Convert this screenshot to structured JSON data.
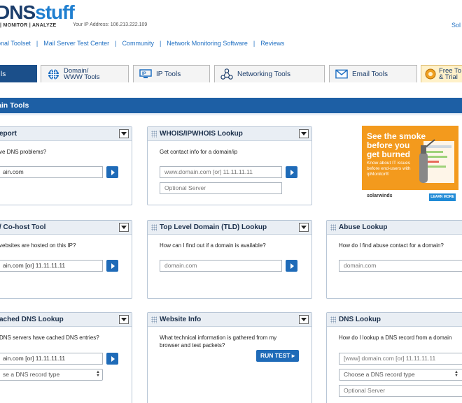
{
  "header": {
    "logo_text": "DNS",
    "logo_suffix": "stuff",
    "logo_tagline": "| MONITOR | ANALYZE",
    "ip_text": "Your IP Address: 106.213.222.109",
    "top_right_link": "Sol"
  },
  "topnav": {
    "items": [
      "onal Toolset",
      "Mail Server Test Center",
      "Community",
      "Network Monitoring Software",
      "Reviews"
    ],
    "separator": "|"
  },
  "tabs": [
    {
      "label": "ls",
      "active": true,
      "icon": "tools-icon"
    },
    {
      "label1": "Domain/",
      "label2": "WWW Tools",
      "icon": "globe-icon"
    },
    {
      "label": "IP Tools",
      "icon": "ip-icon"
    },
    {
      "label": "Networking Tools",
      "icon": "network-icon"
    },
    {
      "label": "Email Tools",
      "icon": "envelope-icon"
    },
    {
      "label1": "Free To",
      "label2": "& Trial",
      "icon": "gear-icon"
    }
  ],
  "section_title": "ain Tools",
  "cards": {
    "report": {
      "title": "eport",
      "question": "ve DNS problems?",
      "input_value": "ain.com"
    },
    "whois": {
      "title": "WHOIS/IPWHOIS Lookup",
      "question": "Get contact info for a domain/ip",
      "input_placeholder": "www.domain.com [or] 11.11.11.11",
      "server_placeholder": "Optional Server"
    },
    "cohost": {
      "title": "/ Co-host Tool",
      "question": "vebsites are hosted on this IP?",
      "input_value": "ain.com [or] 11.11.11.11"
    },
    "tld": {
      "title": "Top Level Domain (TLD) Lookup",
      "question": "How can I find out if a domain is available?",
      "input_placeholder": "domain.com"
    },
    "abuse": {
      "title": "Abuse Lookup",
      "question": "How do I find abuse contact for a domain?",
      "input_placeholder": "domain.com"
    },
    "cached": {
      "title": "ached DNS Lookup",
      "question": "DNS servers have cached DNS entries?",
      "input_value": "ain.com [or] 11.11.11.11",
      "select_value": "se a DNS record type"
    },
    "website": {
      "title": "Website Info",
      "question_line1": "What technical information is gathered from my",
      "question_line2": "browser and test packets?",
      "button": "RUN TEST"
    },
    "dnslookup": {
      "title": "DNS Lookup",
      "question": "How do I lookup a DNS record from a domain",
      "input_placeholder": "[www] domain.com [or] 11.11.11.11",
      "select_value": "Choose a DNS record type",
      "server_placeholder": "Optional Server"
    }
  },
  "ad": {
    "headline1": "See the smoke",
    "headline2": "before you",
    "headline3": "get burned",
    "body": "Know about IT issues before end-users with ipMonitor®",
    "brand": "solarwinds",
    "cta": "LEARN MORE",
    "color": "#f39a1d"
  }
}
